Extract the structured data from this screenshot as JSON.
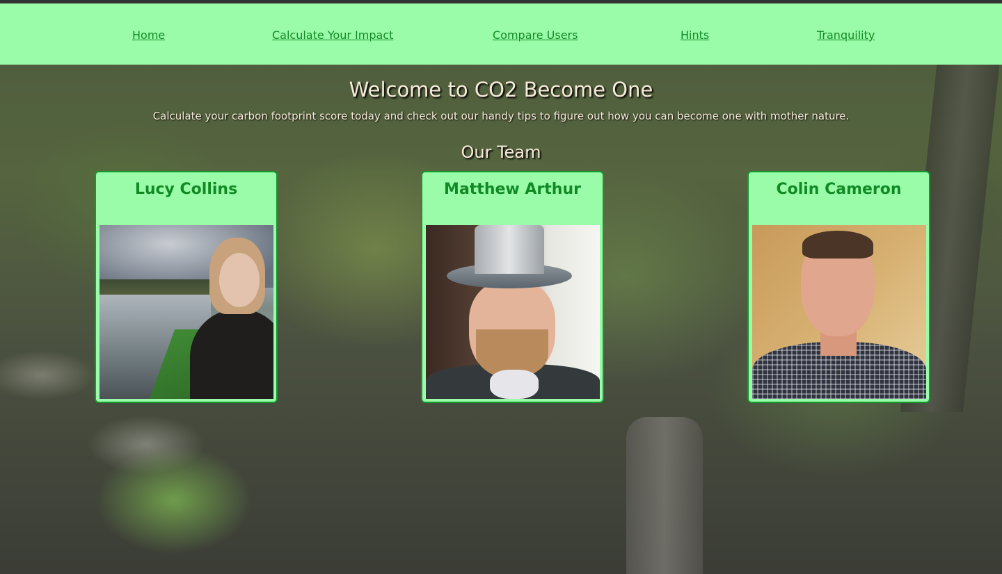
{
  "nav": {
    "links": [
      {
        "label": "Home"
      },
      {
        "label": "Calculate Your Impact"
      },
      {
        "label": "Compare Users"
      },
      {
        "label": "Hints"
      },
      {
        "label": "Tranquility"
      }
    ]
  },
  "hero": {
    "title": "Welcome to CO2 Become One",
    "subtitle": "Calculate your carbon footprint score today and check out our handy tips to figure out how you can become one with mother nature."
  },
  "team": {
    "heading": "Our Team",
    "members": [
      {
        "name": "Lucy Collins"
      },
      {
        "name": "Matthew Arthur"
      },
      {
        "name": "Colin Cameron"
      }
    ]
  },
  "colors": {
    "nav_bg": "#9afca8",
    "link": "#118a26",
    "card_border": "#139a2e",
    "heading_text": "#f5ead7"
  }
}
